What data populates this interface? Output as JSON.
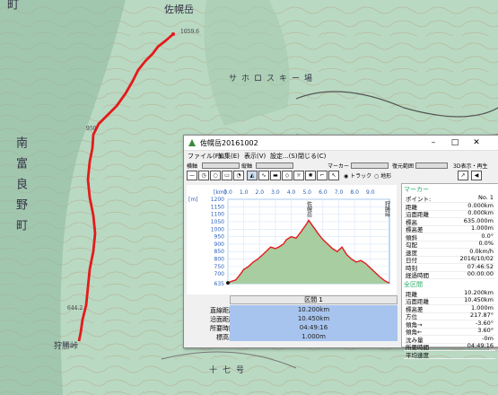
{
  "map": {
    "labels": {
      "peak": "佐幌岳",
      "town_left": "町",
      "region": "南富良野町",
      "sahoro_ski": "サホロスキー場",
      "pass": "狩勝峠",
      "nanasen": "十七号",
      "elev_top": "1059.6",
      "elev_mid": "950",
      "elev_low": "644.2"
    }
  },
  "window": {
    "title": "佐幌岳20161002",
    "buttons": {
      "minimize": "–",
      "maximize": "□",
      "close": "✕"
    },
    "menu": [
      "ファイル(F)",
      "編集(E)",
      "表示(V)",
      "設定...(S)",
      "閉じる(C)"
    ],
    "toolbar": {
      "h_label": "横軸",
      "v_label": "縦軸",
      "marker_label": "マーカー",
      "range_label": "復元範囲",
      "display3d": "3D表示・再生",
      "radio_track": "トラック",
      "radio_terrain": "地形"
    },
    "stats": {
      "header": "区間 1",
      "rows": [
        {
          "label": "直線距離",
          "value": "10.200km"
        },
        {
          "label": "沿面距離",
          "value": "10.450km"
        },
        {
          "label": "所要時間",
          "value": "04:49:16"
        },
        {
          "label": "標高差",
          "value": "1.000m"
        }
      ]
    },
    "panel": {
      "marker_title": "マーカー",
      "marker_rows": [
        {
          "k": "ポイント:",
          "v": "No. 1"
        },
        {
          "k": "距離",
          "v": "0.000km"
        },
        {
          "k": "沿面距離",
          "v": "0.000km"
        },
        {
          "k": "標高",
          "v": "635.000m"
        },
        {
          "k": "標高差",
          "v": "1.000m"
        },
        {
          "k": "傾斜",
          "v": "0.0°"
        },
        {
          "k": "勾配",
          "v": "0.0%"
        },
        {
          "k": "速度",
          "v": "0.0km/h"
        },
        {
          "k": "日付",
          "v": "2016/10/02"
        },
        {
          "k": "時刻",
          "v": "07:46:52"
        },
        {
          "k": "経過時間",
          "v": "00:00:00"
        }
      ],
      "all_title": "全区間",
      "all_rows": [
        {
          "k": "距離",
          "v": "10.200km"
        },
        {
          "k": "沿面距離",
          "v": "10.450km"
        },
        {
          "k": "標高差",
          "v": "1.000m"
        },
        {
          "k": "方位",
          "v": "217.87°"
        },
        {
          "k": "傾角→",
          "v": "-3.60°"
        },
        {
          "k": "傾角←",
          "v": "3.60°"
        },
        {
          "k": "沈み量",
          "v": "-0m"
        },
        {
          "k": "所要時間",
          "v": "04:49:16"
        },
        {
          "k": "平均速度",
          "v": ""
        }
      ]
    }
  },
  "chart_data": {
    "type": "area",
    "xlabel": "[km]",
    "ylabel": "[m]",
    "xlim": [
      0,
      10.2
    ],
    "ylim": [
      635,
      1200
    ],
    "x_ticks": [
      "0.0",
      "1.0",
      "2.0",
      "3.0",
      "4.0",
      "5.0",
      "6.0",
      "7.0",
      "8.0",
      "9.0"
    ],
    "y_ticks": [
      "1200",
      "1150",
      "1100",
      "1050",
      "1000",
      "950",
      "900",
      "850",
      "800",
      "750",
      "700",
      "635"
    ],
    "annotations": [
      {
        "text": "佐幌岳",
        "x": 5.1
      },
      {
        "text": "狩勝峠",
        "x": 10.2
      }
    ],
    "x": [
      0,
      0.2,
      0.5,
      0.8,
      1.0,
      1.3,
      1.6,
      1.9,
      2.2,
      2.5,
      2.7,
      3.0,
      3.2,
      3.5,
      3.7,
      4.0,
      4.3,
      4.6,
      4.8,
      5.0,
      5.1,
      5.3,
      5.5,
      5.7,
      6.0,
      6.3,
      6.6,
      6.9,
      7.2,
      7.5,
      7.8,
      8.1,
      8.4,
      8.7,
      9.0,
      9.3,
      9.6,
      9.9,
      10.2
    ],
    "y": [
      640,
      650,
      660,
      700,
      730,
      750,
      780,
      800,
      830,
      860,
      880,
      870,
      880,
      900,
      930,
      950,
      940,
      980,
      1010,
      1040,
      1060,
      1030,
      1000,
      970,
      930,
      900,
      870,
      850,
      880,
      830,
      800,
      780,
      790,
      770,
      740,
      710,
      680,
      655,
      640
    ]
  }
}
